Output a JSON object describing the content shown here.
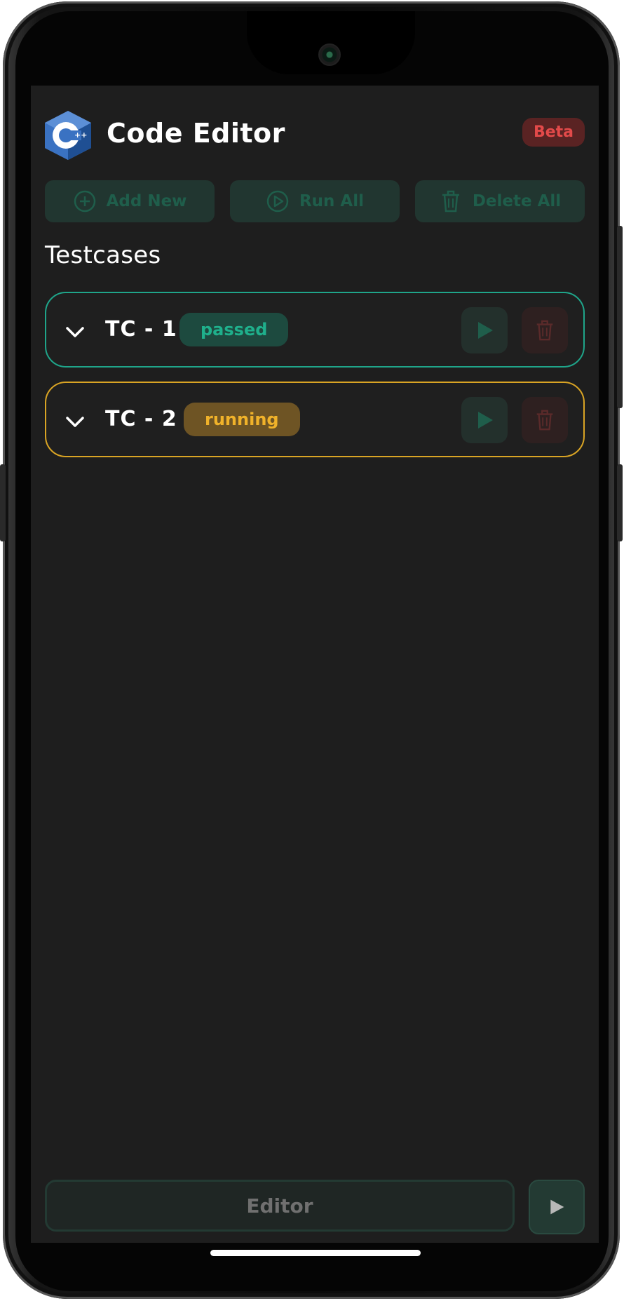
{
  "app": {
    "title": "Code Editor",
    "badge": "Beta",
    "logo_icon": "cpp-logo-icon"
  },
  "toolbar": {
    "add_new": "Add New",
    "run_all": "Run All",
    "delete_all": "Delete All"
  },
  "section": {
    "title": "Testcases"
  },
  "testcases": [
    {
      "label": "TC - 1",
      "status": "passed"
    },
    {
      "label": "TC - 2",
      "status": "running"
    }
  ],
  "bottom": {
    "editor_label": "Editor"
  },
  "colors": {
    "background": "#1e1e1e",
    "accent_green": "#1fa58a",
    "accent_yellow": "#d9a424",
    "accent_red": "#e34a4a"
  }
}
